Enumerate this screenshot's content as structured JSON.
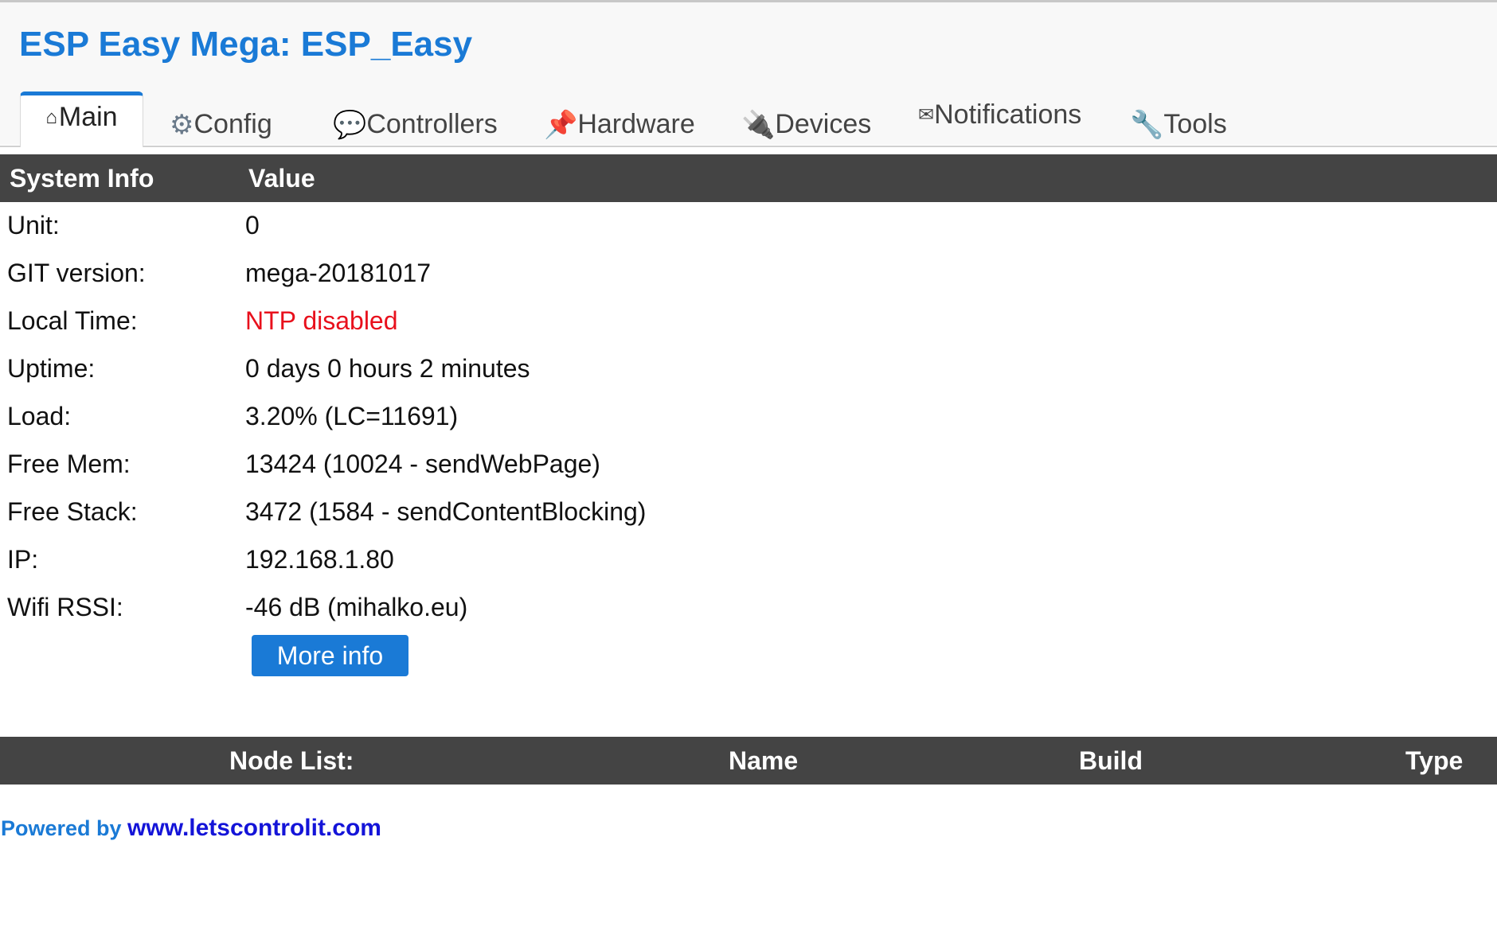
{
  "app": {
    "title": "ESP Easy Mega: ESP_Easy"
  },
  "tabs": [
    {
      "label": "Main",
      "icon": "home-icon",
      "glyph": "⌂",
      "active": true
    },
    {
      "label": "Config",
      "icon": "gear-icon",
      "glyph": "⚙",
      "active": false
    },
    {
      "label": "Controllers",
      "icon": "speech-bubble-icon",
      "glyph": "💬",
      "active": false
    },
    {
      "label": "Hardware",
      "icon": "pushpin-icon",
      "glyph": "📌",
      "active": false
    },
    {
      "label": "Devices",
      "icon": "plug-icon",
      "glyph": "🔌",
      "active": false
    },
    {
      "label": "Notifications",
      "icon": "envelope-icon",
      "glyph": "✉",
      "active": false
    },
    {
      "label": "Tools",
      "icon": "wrench-icon",
      "glyph": "🔧",
      "active": false
    }
  ],
  "system_info": {
    "header_label": "System Info",
    "header_value": "Value",
    "rows": [
      {
        "label": "Unit:",
        "value": "0"
      },
      {
        "label": "GIT version:",
        "value": "mega-20181017"
      },
      {
        "label": "Local Time:",
        "value": "NTP disabled"
      },
      {
        "label": "Uptime:",
        "value": "0 days 0 hours 2 minutes"
      },
      {
        "label": "Load:",
        "value": "3.20% (LC=11691)"
      },
      {
        "label": "Free Mem:",
        "value": "13424 (10024 - sendWebPage)"
      },
      {
        "label": "Free Stack:",
        "value": "3472 (1584 - sendContentBlocking)"
      },
      {
        "label": "IP:",
        "value": "192.168.1.80"
      },
      {
        "label": "Wifi RSSI:",
        "value": "-46 dB (mihalko.eu)"
      }
    ],
    "more_info_label": "More info"
  },
  "node_list": {
    "col_node": "Node List:",
    "col_name": "Name",
    "col_build": "Build",
    "col_type": "Type"
  },
  "footer": {
    "prefix": "Powered by ",
    "link_text": "www.letscontrolit.com"
  },
  "colors": {
    "accent": "#1a7ad6",
    "header_bar": "#444444",
    "error_text": "#e8101c",
    "link": "#1414d8"
  }
}
